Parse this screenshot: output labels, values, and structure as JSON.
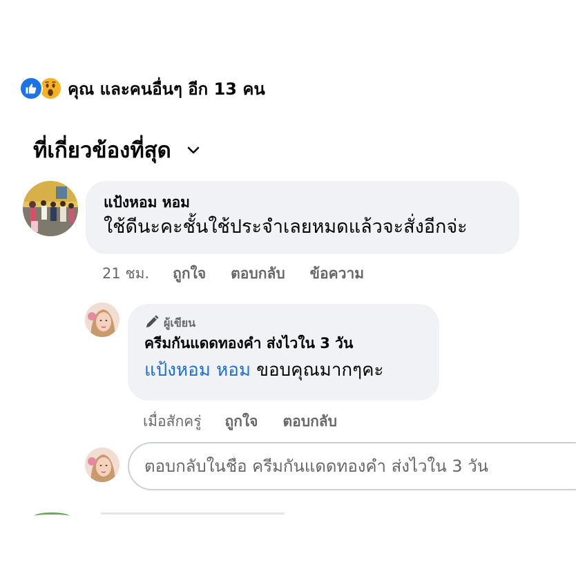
{
  "reactions": {
    "icons": [
      "like-icon",
      "wow-icon"
    ],
    "summary": "คุณ และคนอื่นๆ อีก 13 คน"
  },
  "sort": {
    "label": "ที่เกี่ยวข้องที่สุด",
    "icon": "chevron-down-icon"
  },
  "comment": {
    "author": "แป้งหอม หอม",
    "text": "ใช้ดีนะคะชั้นใช้ประจำเลยหมดแล้วจะสั่งอีกจ่ะ",
    "time": "21 ชม.",
    "actions": {
      "like": "ถูกใจ",
      "reply": "ตอบกลับ",
      "message": "ข้อความ"
    }
  },
  "reply": {
    "badge": "ผู้เขียน",
    "badge_icon": "pencil-icon",
    "author": "ครีมกันแดดทองคำ ส่งไวใน 3 วัน",
    "mention": "แป้งหอม หอม",
    "text": " ขอบคุณมากๆคะ",
    "time": "เมื่อสักครู่",
    "actions": {
      "like": "ถูกใจ",
      "reply": "ตอบกลับ"
    }
  },
  "composer": {
    "placeholder": "ตอบกลับในชื่อ ครีมกันแดดทองคำ ส่งไวใน 3 วัน"
  },
  "colors": {
    "like_blue": "#1b74e4",
    "wow_yellow": "#f7b125",
    "mention_blue": "#1b6fd1",
    "bubble_bg": "#f0f2f5",
    "secondary_text": "#65676b"
  }
}
